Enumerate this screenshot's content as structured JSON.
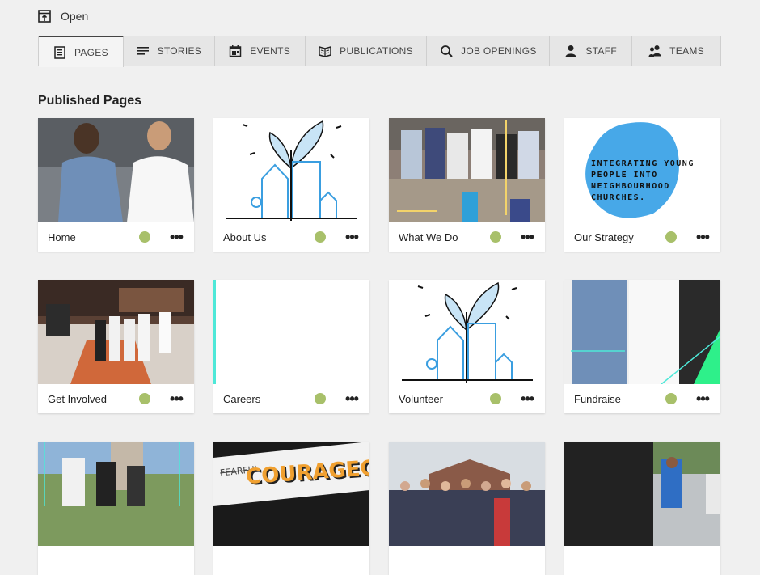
{
  "topbar": {
    "label": "Open",
    "icon": "open-icon"
  },
  "tabs": [
    {
      "label": "PAGES",
      "icon": "page-icon",
      "active": true
    },
    {
      "label": "STORIES",
      "icon": "lines-icon"
    },
    {
      "label": "EVENTS",
      "icon": "calendar-icon"
    },
    {
      "label": "PUBLICATIONS",
      "icon": "book-icon"
    },
    {
      "label": "JOB OPENINGS",
      "icon": "search-icon"
    },
    {
      "label": "STAFF",
      "icon": "person-icon"
    },
    {
      "label": "TEAMS",
      "icon": "group-icon"
    }
  ],
  "section": {
    "title": "Published Pages"
  },
  "cards": [
    {
      "label": "Home",
      "thumb": "photo-two-men"
    },
    {
      "label": "About Us",
      "thumb": "illustration-sprout-city"
    },
    {
      "label": "What We Do",
      "thumb": "photo-group"
    },
    {
      "label": "Our Strategy",
      "thumb": "text-graphic",
      "thumb_text": "INTEGRATING YOUNG PEOPLE INTO NEIGHBOURHOOD CHURCHES."
    },
    {
      "label": "Get Involved",
      "thumb": "photo-martial-arts"
    },
    {
      "label": "Careers",
      "thumb": "blank"
    },
    {
      "label": "Volunteer",
      "thumb": "illustration-sprout-city"
    },
    {
      "label": "Fundraise",
      "thumb": "photo-two-men-cropped"
    },
    {
      "label": "",
      "thumb": "photo-outdoor-team"
    },
    {
      "label": "",
      "thumb": "graffiti",
      "thumb_text": "COURAGEOUS",
      "thumb_text_2": "FEARFUL"
    },
    {
      "label": "",
      "thumb": "photo-crowd"
    },
    {
      "label": "",
      "thumb": "photo-street"
    }
  ],
  "colors": {
    "status_published": "#a8c06a",
    "accent_teal": "#4ee8d8",
    "accent_blue": "#3a9ee0"
  }
}
